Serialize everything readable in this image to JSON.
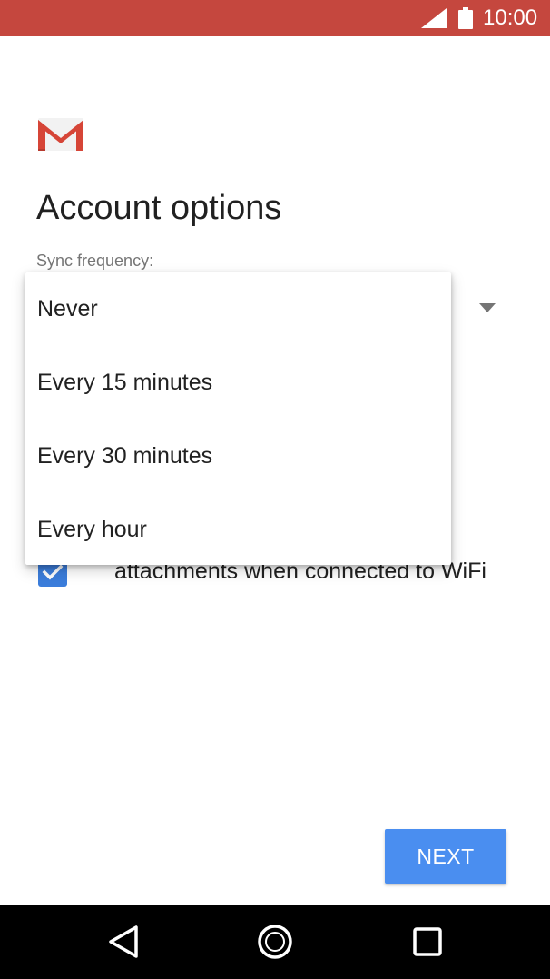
{
  "status_bar": {
    "time": "10:00",
    "background": "#c5473e",
    "icons": [
      "signal-icon",
      "battery-icon"
    ]
  },
  "header": {
    "logo": "gmail-logo",
    "title": "Account options"
  },
  "sync": {
    "label": "Sync frequency:",
    "options": [
      "Never",
      "Every 15 minutes",
      "Every 30 minutes",
      "Every hour"
    ]
  },
  "wifi_option": {
    "checked": true,
    "label_visible": "attachments when connected to WiFi"
  },
  "actions": {
    "next_label": "NEXT",
    "next_color": "#4a8ef0"
  },
  "nav": {
    "icons": [
      "back-icon",
      "home-icon",
      "recents-icon"
    ]
  }
}
